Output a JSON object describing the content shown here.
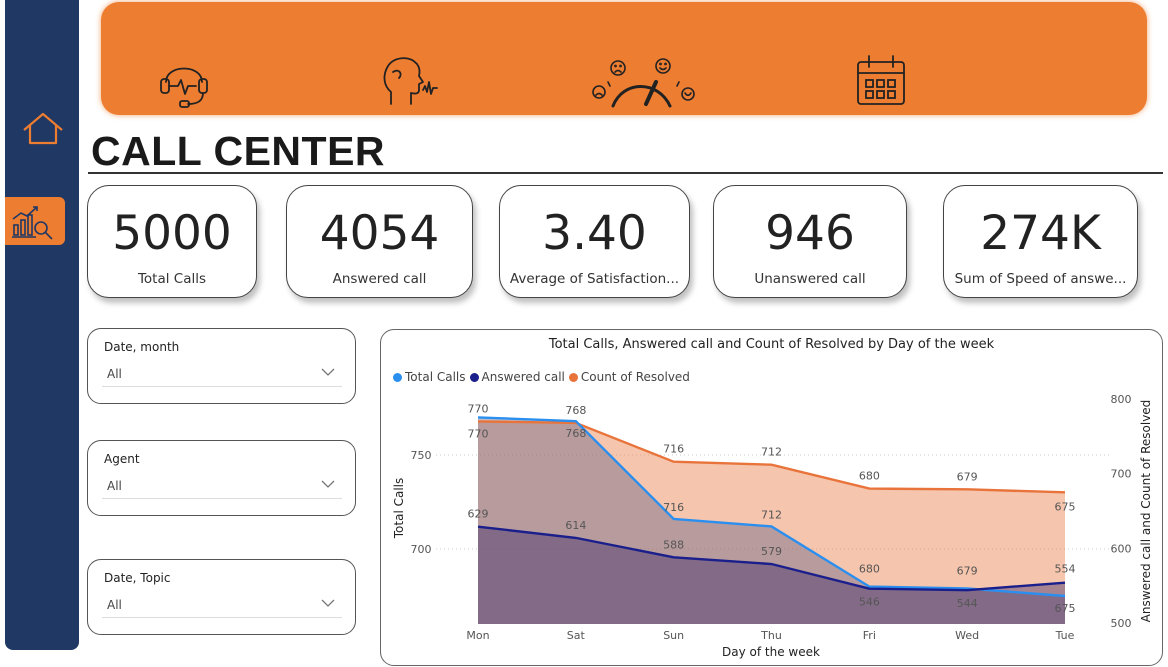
{
  "nav": {
    "home_icon": "home-icon",
    "report_icon": "analytics-report-icon"
  },
  "banner": {
    "icons": [
      "headset-icon",
      "speaking-head-icon",
      "satisfaction-gauge-icon",
      "calendar-icon"
    ],
    "color": "#ed7d31"
  },
  "page": {
    "title": "CALL CENTER"
  },
  "kpis": [
    {
      "value": "5000",
      "label": "Total Calls"
    },
    {
      "value": "4054",
      "label": "Answered call"
    },
    {
      "value": "3.40",
      "label": "Average of Satisfaction..."
    },
    {
      "value": "946",
      "label": "Unanswered call"
    },
    {
      "value": "274K",
      "label": "Sum of Speed of answe..."
    }
  ],
  "slicers": [
    {
      "label": "Date, month",
      "value": "All"
    },
    {
      "label": "Agent",
      "value": "All"
    },
    {
      "label": "Date, Topic",
      "value": "All"
    }
  ],
  "colors": {
    "total_calls": "#2b8ff0",
    "answered": "#1a1f8c",
    "resolved": "#e8743b",
    "sidebar": "#1f3864"
  },
  "chart_data": {
    "type": "area",
    "title": "Total Calls, Answered call and Count of Resolved by Day of the week",
    "xlabel": "Day of the week",
    "ylabel_left": "Total Calls",
    "ylabel_right": "Answered call and Count of Resolved",
    "categories": [
      "Mon",
      "Sat",
      "Sun",
      "Thu",
      "Fri",
      "Wed",
      "Tue"
    ],
    "left_axis": {
      "ticks": [
        700,
        750
      ]
    },
    "right_axis": {
      "ticks": [
        500,
        600,
        700,
        800
      ],
      "ylim": [
        500,
        800
      ]
    },
    "legend_position": "top-left",
    "series": [
      {
        "name": "Total Calls",
        "axis": "left",
        "values": [
          770,
          768,
          716,
          712,
          680,
          679,
          675
        ],
        "labels": [
          "770",
          "768",
          "716",
          "712",
          "680",
          "679",
          "675"
        ]
      },
      {
        "name": "Answered call",
        "axis": "right",
        "values": [
          629,
          614,
          588,
          579,
          546,
          544,
          554
        ],
        "labels": [
          "629",
          "614",
          "588",
          "579",
          "546",
          "544",
          "554"
        ]
      },
      {
        "name": "Count of Resolved",
        "axis": "right",
        "values": [
          770,
          768,
          716,
          712,
          680,
          679,
          675
        ],
        "labels": [
          "770",
          "768",
          "716",
          "712",
          "680",
          "679",
          "675"
        ]
      }
    ]
  }
}
